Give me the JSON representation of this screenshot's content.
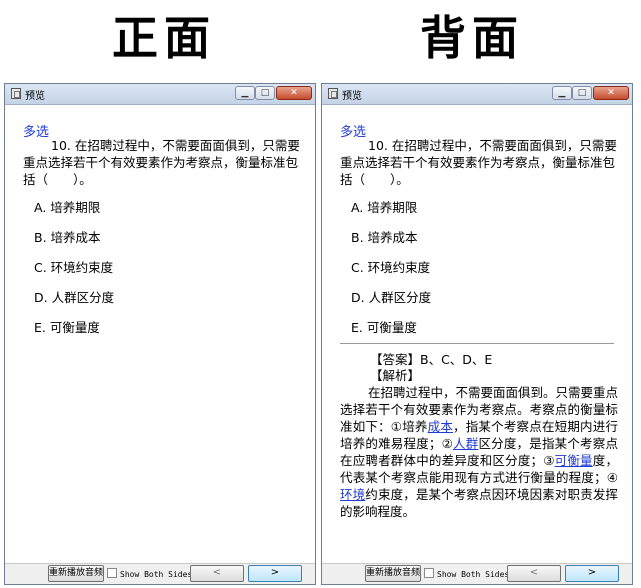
{
  "headings": {
    "front": "正面",
    "back": "背面"
  },
  "front_window": {
    "title": "预览",
    "question_type": "多选",
    "question": "10. 在招聘过程中，不需要面面俱到，只需要重点选择若干个有效要素作为考察点，衡量标准包括（　　）。",
    "options": [
      "A.  培养期限",
      "B.  培养成本",
      "C.  环境约束度",
      "D.  人群区分度",
      "E.  可衡量度"
    ],
    "replay_label": "重新播放音频",
    "show_both_label": "Show Both Sides",
    "prev_label": "<",
    "next_label": ">"
  },
  "back_window": {
    "title": "预览",
    "question_type": "多选",
    "question": "10. 在招聘过程中，不需要面面俱到，只需要重点选择若干个有效要素作为考察点，衡量标准包括（　　）。",
    "options": [
      "A.  培养期限",
      "B.  培养成本",
      "C.  环境约束度",
      "D.  人群区分度",
      "E.  可衡量度"
    ],
    "answer": "【答案】B、C、D、E",
    "analysis_label": "【解析】",
    "explanation": {
      "p1": "在招聘过程中，不需要面面俱到。只需要重点选择若干个有效要素作为考察点。考察点的衡量标准如下：①培养",
      "l1": "成本",
      "p2": "，指某个考察点在短期内进行培养的难易程度；②",
      "l2": "人群",
      "p3": "区分度，是指某个考察点在应聘者群体中的差异度和区分度；③",
      "l3": "可衡量",
      "p4": "度，代表某个考察点能用现有方式进行衡量的程度；④",
      "l4": "环境",
      "p5": "约束度，是某个考察点因环境因素对职责发挥的影响程度。"
    },
    "replay_label": "重新播放音频",
    "show_both_label": "Show Both Sides",
    "prev_label": "<",
    "next_label": ">"
  },
  "colors": {
    "accent_blue": "#1e3bd4",
    "close_red": "#c44b2d"
  }
}
